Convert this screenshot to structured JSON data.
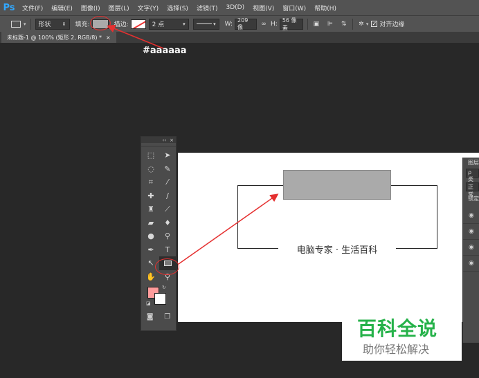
{
  "app": {
    "logo": "Ps"
  },
  "menu": [
    "文件(F)",
    "编辑(E)",
    "图像(I)",
    "图层(L)",
    "文字(Y)",
    "选择(S)",
    "滤镜(T)",
    "3D(D)",
    "视图(V)",
    "窗口(W)",
    "帮助(H)"
  ],
  "options": {
    "mode_value": "形状",
    "fill_label": "填充:",
    "fill_color": "#aaaaaa",
    "stroke_label": "描边:",
    "stroke_size": "2 点",
    "w_label": "W:",
    "w_value": "209 像",
    "h_label": "H:",
    "h_value": "56 像素",
    "align_edges_label": "对齐边缘",
    "align_edges_checked": true
  },
  "document": {
    "tab_title": "未标题-1 @ 100% (矩形 2, RGB/8) *",
    "close": "×"
  },
  "annotation": {
    "label": "#aaaaaa",
    "color": "#e53030"
  },
  "canvas": {
    "caption": "电脑专家 · 生活百科"
  },
  "toolbar": {
    "foreground_color": "#ff9c9c",
    "background_color": "#ffffff",
    "collapse": "‹‹",
    "close": "×"
  },
  "layers_panel": {
    "title": "图层",
    "search": "ρ 类",
    "blend": "正常",
    "lock_label": "锁定"
  },
  "watermark": {
    "big": "百科全说",
    "small": "助你轻松解决"
  }
}
